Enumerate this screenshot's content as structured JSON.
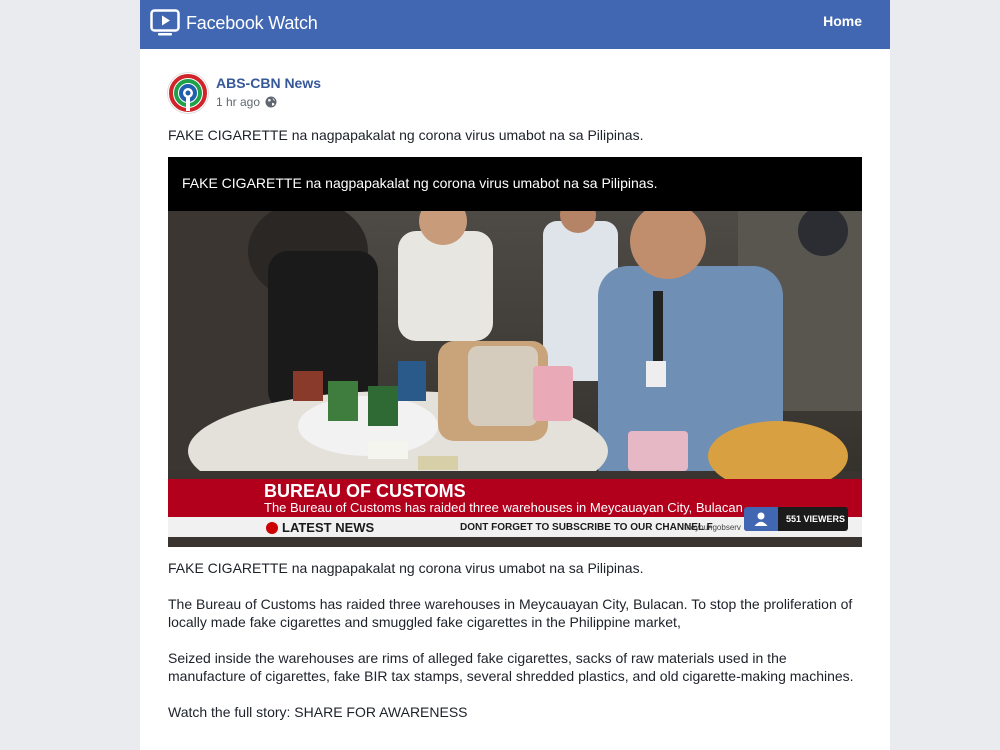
{
  "header": {
    "brand_icon": "video-play-icon",
    "title": "Facebook Watch",
    "home_label": "Home",
    "color": "#4267b2"
  },
  "post": {
    "author": "ABS-CBN News",
    "avatar_icon": "abs-cbn-logo",
    "time": "1 hr ago",
    "privacy_icon": "globe-icon",
    "caption": "FAKE CIGARETTE na nagpapakalat ng corona virus umabot na sa Pilipinas.",
    "video": {
      "title": "FAKE CIGARETTE na nagpapakalat ng corona virus umabot na sa Pilipinas.",
      "lower_third_title": "BUREAU OF CUSTOMS",
      "lower_third_sub": "The Bureau of Customs has raided three warehouses in Meycauayan City, Bulacan",
      "ticker_label": "LATEST NEWS",
      "ticker_message": "DONT FORGET TO SUBSCRIBE TO OUR CHANNEL F",
      "ticker_site": "theyoungobserv",
      "viewers": "551 VIEWERS",
      "accent_color": "#b2001c"
    },
    "paragraphs": [
      "FAKE CIGARETTE na nagpapakalat ng corona virus umabot na sa Pilipinas.",
      "The Bureau of Customs has raided three warehouses in Meycauayan City, Bulacan. To stop the proliferation of locally made fake cigarettes and smuggled fake cigarettes in the Philippine market,",
      "Seized inside the warehouses are rims of alleged fake cigarettes, sacks of raw materials used in the manufacture of cigarettes, fake BIR tax stamps, several shredded plastics, and old cigarette-making machines.",
      "Watch the full story: SHARE FOR AWARENESS"
    ]
  }
}
